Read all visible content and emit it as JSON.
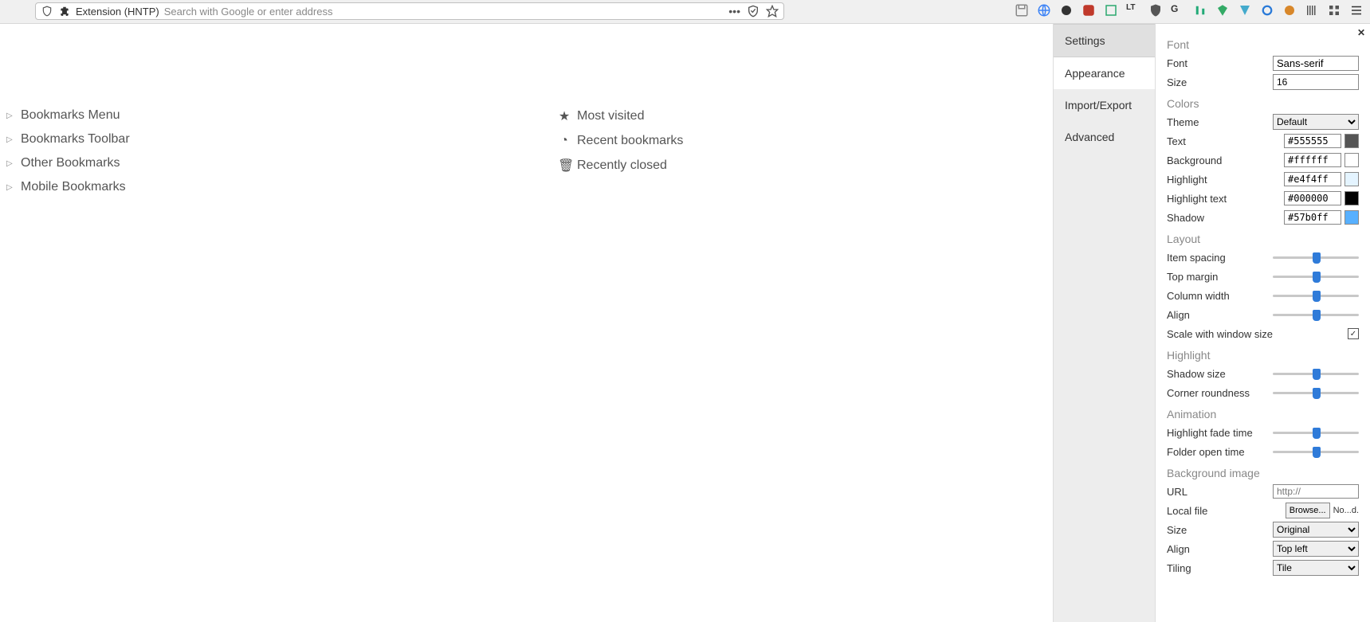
{
  "topbar": {
    "extension_label": "Extension (HNTP)",
    "search_placeholder": "Search with Google or enter address"
  },
  "bookmarks": {
    "left": [
      {
        "label": "Bookmarks Menu",
        "caret": true
      },
      {
        "label": "Bookmarks Toolbar",
        "caret": true
      },
      {
        "label": "Other Bookmarks",
        "caret": true
      },
      {
        "label": "Mobile Bookmarks",
        "caret": true
      }
    ],
    "right": [
      {
        "label": "Most visited",
        "glyph": "★"
      },
      {
        "label": "Recent bookmarks",
        "glyph": "◔"
      },
      {
        "label": "Recently closed",
        "glyph": "🗑"
      }
    ]
  },
  "settings": {
    "tabs": [
      "Settings",
      "Appearance",
      "Import/Export",
      "Advanced"
    ],
    "active_tab": "Appearance",
    "font": {
      "section": "Font",
      "label_font": "Font",
      "value_font": "Sans-serif",
      "label_size": "Size",
      "value_size": "16"
    },
    "colors": {
      "section": "Colors",
      "theme_label": "Theme",
      "theme_value": "Default",
      "items": [
        {
          "label": "Text",
          "value": "#555555",
          "swatch": "#555555"
        },
        {
          "label": "Background",
          "value": "#ffffff",
          "swatch": "#ffffff"
        },
        {
          "label": "Highlight",
          "value": "#e4f4ff",
          "swatch": "#e4f4ff"
        },
        {
          "label": "Highlight text",
          "value": "#000000",
          "swatch": "#000000"
        },
        {
          "label": "Shadow",
          "value": "#57b0ff",
          "swatch": "#57b0ff"
        }
      ]
    },
    "layout": {
      "section": "Layout",
      "items": [
        {
          "label": "Item spacing",
          "pos": 50
        },
        {
          "label": "Top margin",
          "pos": 50
        },
        {
          "label": "Column width",
          "pos": 50
        },
        {
          "label": "Align",
          "pos": 50
        }
      ],
      "scale_label": "Scale with window size",
      "scale_checked": true
    },
    "highlight": {
      "section": "Highlight",
      "items": [
        {
          "label": "Shadow size",
          "pos": 50
        },
        {
          "label": "Corner roundness",
          "pos": 50
        }
      ]
    },
    "animation": {
      "section": "Animation",
      "items": [
        {
          "label": "Highlight fade time",
          "pos": 50
        },
        {
          "label": "Folder open time",
          "pos": 50
        }
      ]
    },
    "bgimage": {
      "section": "Background image",
      "url_label": "URL",
      "url_placeholder": "http://",
      "localfile_label": "Local file",
      "browse_label": "Browse...",
      "file_status": "No...d.",
      "size_label": "Size",
      "size_value": "Original",
      "align_label": "Align",
      "align_value": "Top left",
      "tiling_label": "Tiling",
      "tiling_value": "Tile"
    }
  }
}
